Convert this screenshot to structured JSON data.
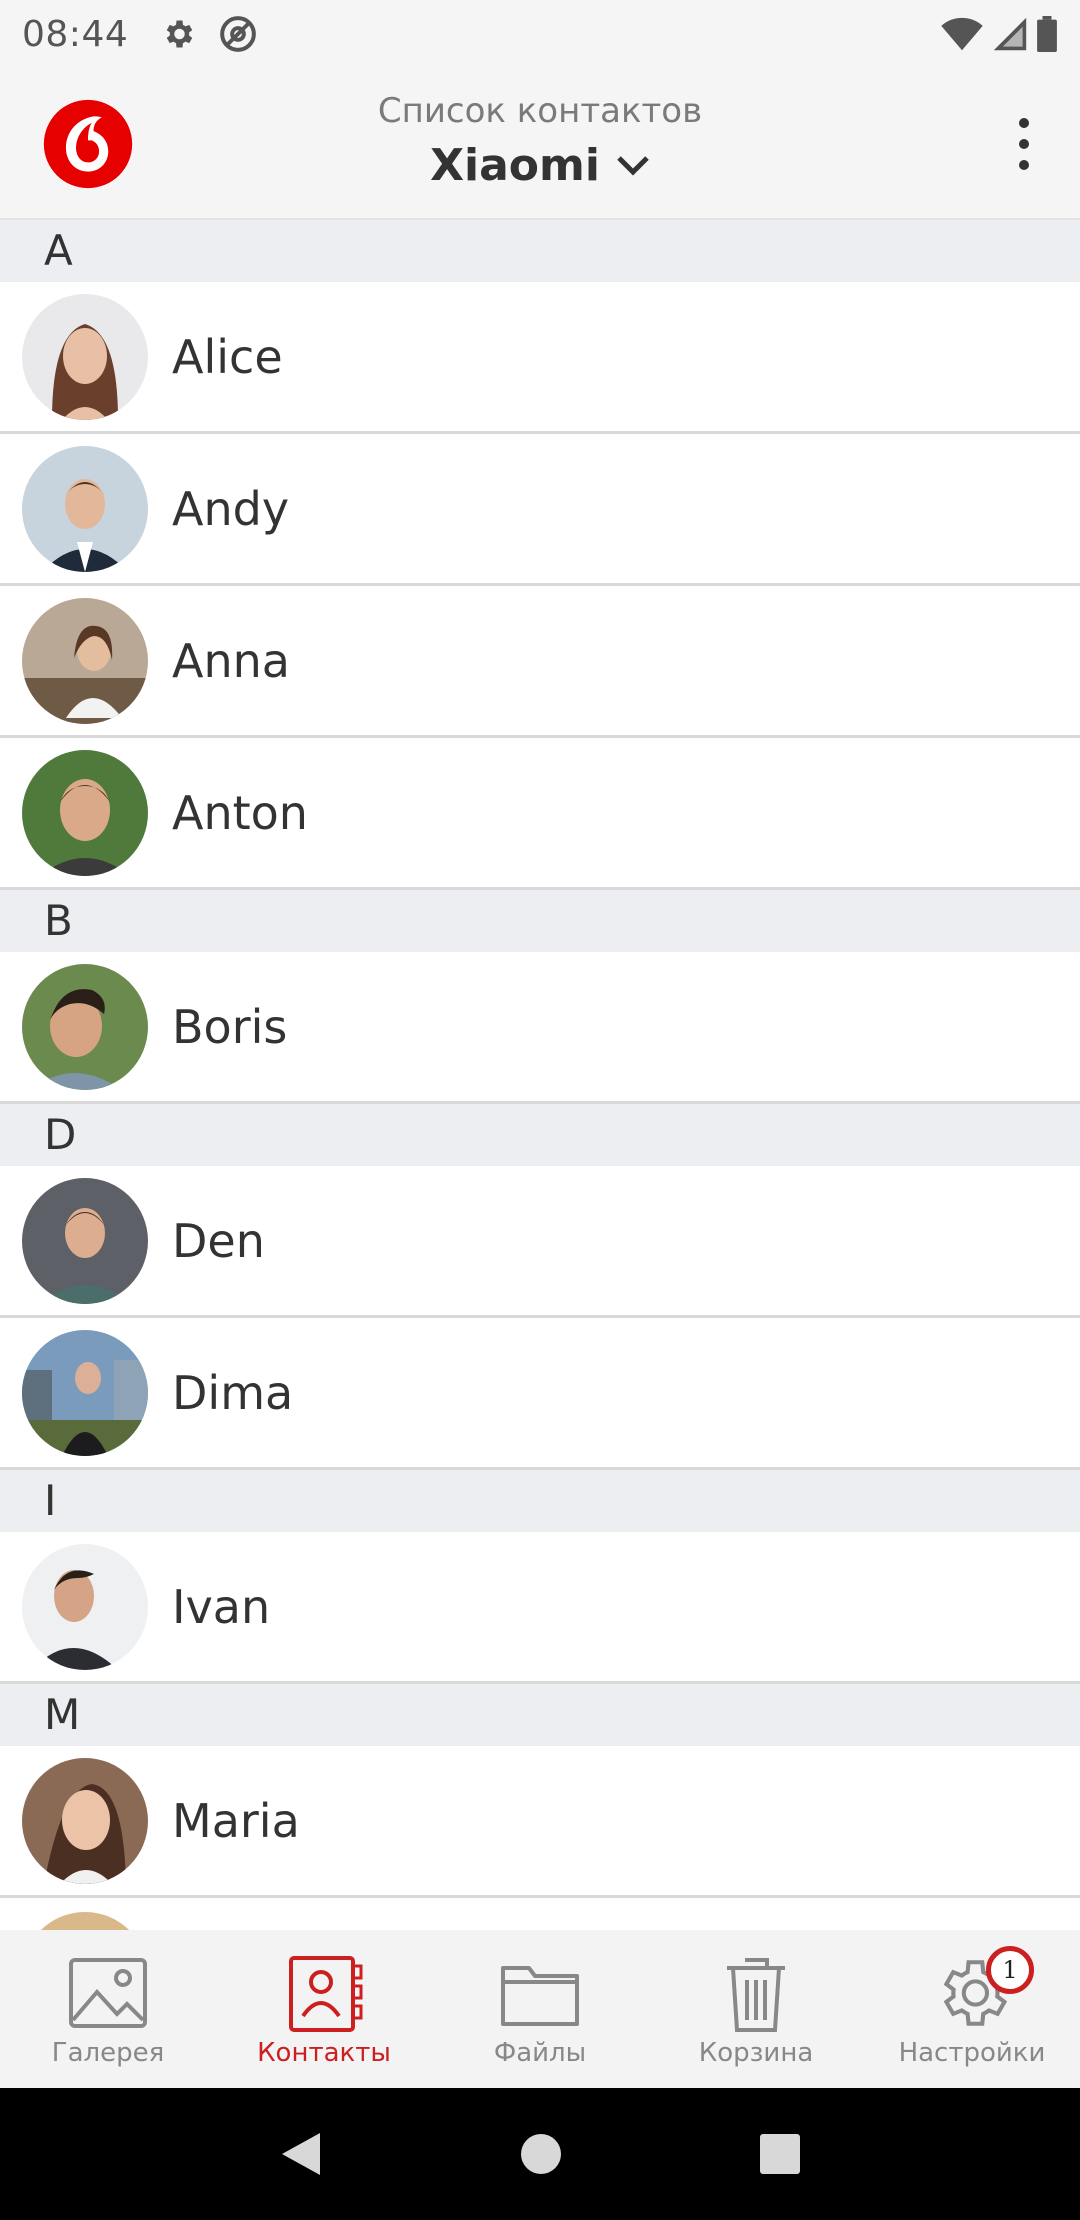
{
  "status_bar": {
    "time": "08:44"
  },
  "app_bar": {
    "subtitle": "Список контактов",
    "device": "Xiaomi"
  },
  "sections": [
    {
      "letter": "A",
      "contacts": [
        "Alice",
        "Andy",
        "Anna",
        "Anton"
      ]
    },
    {
      "letter": "B",
      "contacts": [
        "Boris"
      ]
    },
    {
      "letter": "D",
      "contacts": [
        "Den",
        "Dima"
      ]
    },
    {
      "letter": "I",
      "contacts": [
        "Ivan"
      ]
    },
    {
      "letter": "M",
      "contacts": [
        "Maria"
      ]
    }
  ],
  "bottom_nav": {
    "items": [
      {
        "label": "Галерея",
        "icon": "gallery-icon"
      },
      {
        "label": "Контакты",
        "icon": "contacts-icon",
        "active": true
      },
      {
        "label": "Файлы",
        "icon": "folder-icon"
      },
      {
        "label": "Корзина",
        "icon": "trash-icon"
      },
      {
        "label": "Настройки",
        "icon": "settings-icon",
        "badge": "1"
      }
    ]
  },
  "colors": {
    "accent": "#cc1f1f",
    "header_bg": "#f5f5f5",
    "section_bg": "#eceef1"
  }
}
